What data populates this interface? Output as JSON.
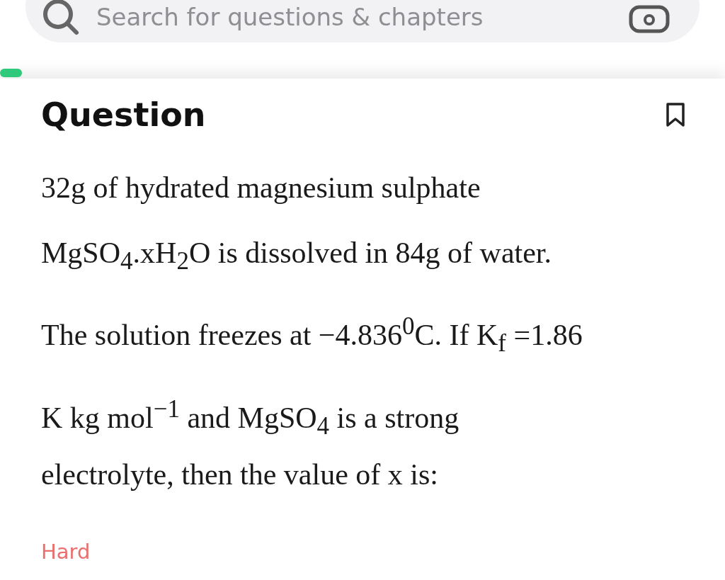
{
  "search": {
    "placeholder": "Search for questions & chapters"
  },
  "progress": {
    "level": 0.03
  },
  "question": {
    "heading": "Question",
    "bookmarked": false,
    "lines": [
      "32g of hydrated magnesium sulphate",
      "MgSO$_{4}$.xH$_{2}$O is dissolved in 84g of water.",
      "The solution freezes at −4.836$^{0}$C. If K$_{f}$ =1.86",
      "K kg mol$^{−1}$ and MgSO$_{4}$ is a strong",
      "electrolyte, then the value of x is:"
    ],
    "difficulty": "Hard"
  }
}
